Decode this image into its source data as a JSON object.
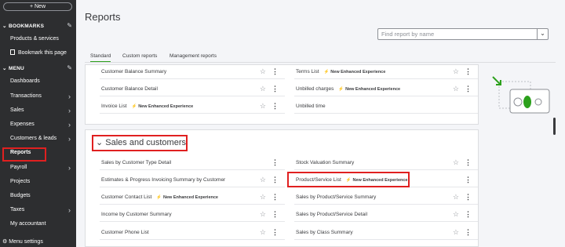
{
  "sidebar": {
    "new_label": "+ New",
    "bookmarks_title": "BOOKMARKS",
    "bookmark_items": [
      "Products & services",
      "Bookmark this page"
    ],
    "menu_title": "MENU",
    "menu_items": [
      {
        "label": "Dashboards",
        "arrow": false
      },
      {
        "label": "Transactions",
        "arrow": true
      },
      {
        "label": "Sales",
        "arrow": true
      },
      {
        "label": "Expenses",
        "arrow": true
      },
      {
        "label": "Customers & leads",
        "arrow": true
      },
      {
        "label": "Reports",
        "arrow": false,
        "active": true
      },
      {
        "label": "Payroll",
        "arrow": true
      },
      {
        "label": "Projects",
        "arrow": false
      },
      {
        "label": "Budgets",
        "arrow": false
      },
      {
        "label": "Taxes",
        "arrow": true
      },
      {
        "label": "My accountant",
        "arrow": false
      }
    ],
    "menu_settings": "Menu settings"
  },
  "main": {
    "title": "Reports",
    "search_placeholder": "Find report by name",
    "tabs": [
      "Standard",
      "Custom reports",
      "Management reports"
    ],
    "nee_label": "New Enhanced Experience",
    "top_card": {
      "left": [
        {
          "label": "Customer Balance Summary"
        },
        {
          "label": "Customer Balance Detail"
        },
        {
          "label": "Invoice List",
          "nee": true
        }
      ],
      "right": [
        {
          "label": "Terms List",
          "nee": true
        },
        {
          "label": "Unbilled charges",
          "nee": true
        },
        {
          "label": "Unbilled time"
        }
      ]
    },
    "group_title": "Sales and customers",
    "group_card": {
      "left": [
        {
          "label": "Sales by Customer Type Detail",
          "star": false
        },
        {
          "label": "Estimates & Progress Invoicing Summary by Customer",
          "star": true
        },
        {
          "label": "Customer Contact List",
          "nee": true,
          "star": true
        },
        {
          "label": "Income by Customer Summary",
          "star": true
        },
        {
          "label": "Customer Phone List",
          "star": true
        }
      ],
      "right": [
        {
          "label": "Stock Valuation Summary",
          "star": true
        },
        {
          "label": "Product/Service List",
          "nee": true,
          "star": false
        },
        {
          "label": "Sales by Product/Service Summary",
          "star": true
        },
        {
          "label": "Sales by Product/Service Detail",
          "star": true
        },
        {
          "label": "Sales by Class Summary",
          "star": true
        }
      ]
    }
  },
  "colors": {
    "sidebar_bg": "#2d2e30",
    "accent_green": "#2ca01c",
    "highlight_red": "#e02020"
  },
  "icons": [
    "pencil-icon",
    "bookmark-icon",
    "gear-icon",
    "star-icon",
    "kebab-icon",
    "wand-icon",
    "chevron-down-icon",
    "chevron-right-icon"
  ]
}
